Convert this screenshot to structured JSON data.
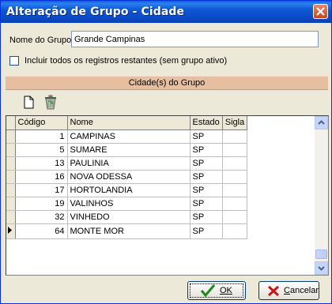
{
  "window": {
    "title": "Alteração de Grupo - Cidade"
  },
  "form": {
    "group_label": "Nome do Grupo",
    "group_value": "Grande Campinas",
    "include_label": "Incluir todos os registros restantes (sem grupo ativo)",
    "include_checked": false
  },
  "section": {
    "title": "Cidade(s) do Grupo"
  },
  "toolbar": {
    "icons": [
      "new-document-icon",
      "recycle-bin-icon"
    ]
  },
  "grid": {
    "columns": [
      "Código",
      "Nome",
      "Estado",
      "Sigla"
    ],
    "rows": [
      {
        "codigo": "1",
        "nome": "CAMPINAS",
        "estado": "SP",
        "sigla": ""
      },
      {
        "codigo": "5",
        "nome": "SUMARE",
        "estado": "SP",
        "sigla": ""
      },
      {
        "codigo": "13",
        "nome": "PAULINIA",
        "estado": "SP",
        "sigla": ""
      },
      {
        "codigo": "16",
        "nome": "NOVA ODESSA",
        "estado": "SP",
        "sigla": ""
      },
      {
        "codigo": "17",
        "nome": "HORTOLANDIA",
        "estado": "SP",
        "sigla": ""
      },
      {
        "codigo": "19",
        "nome": "VALINHOS",
        "estado": "SP",
        "sigla": ""
      },
      {
        "codigo": "32",
        "nome": "VINHEDO",
        "estado": "SP",
        "sigla": ""
      },
      {
        "codigo": "64",
        "nome": "MONTE MOR",
        "estado": "SP",
        "sigla": ""
      }
    ],
    "current_row": 7
  },
  "buttons": {
    "ok": "OK",
    "cancel": "Cancelar"
  }
}
